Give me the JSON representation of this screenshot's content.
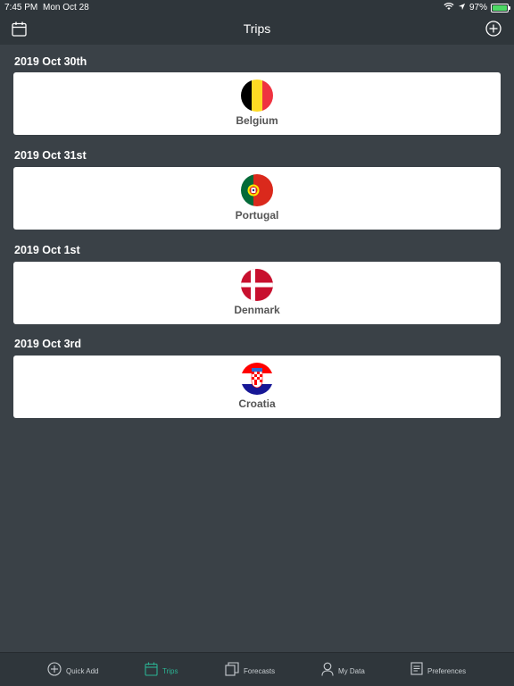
{
  "status_bar": {
    "time": "7:45 PM",
    "date": "Mon Oct 28",
    "battery": "97%",
    "battery_level": 0.97
  },
  "nav": {
    "title": "Trips",
    "left_icon": "calendar-icon",
    "right_icon": "add-circle-icon"
  },
  "trips": [
    {
      "date": "2019 Oct 30th",
      "country": "Belgium",
      "flag": "belgium-flag-icon"
    },
    {
      "date": "2019 Oct 31st",
      "country": "Portugal",
      "flag": "portugal-flag-icon"
    },
    {
      "date": "2019 Oct 1st",
      "country": "Denmark",
      "flag": "denmark-flag-icon"
    },
    {
      "date": "2019 Oct 3rd",
      "country": "Croatia",
      "flag": "croatia-flag-icon"
    }
  ],
  "tabs": [
    {
      "label": "Quick Add",
      "icon": "plus-circle-icon",
      "active": false
    },
    {
      "label": "Trips",
      "icon": "calendar-icon",
      "active": true
    },
    {
      "label": "Forecasts",
      "icon": "copy-icon",
      "active": false
    },
    {
      "label": "My Data",
      "icon": "person-icon",
      "active": false
    },
    {
      "label": "Preferences",
      "icon": "document-icon",
      "active": false
    }
  ],
  "colors": {
    "background": "#3a4147",
    "bar": "#2f363b",
    "accent": "#2bb393",
    "card": "#ffffff"
  }
}
